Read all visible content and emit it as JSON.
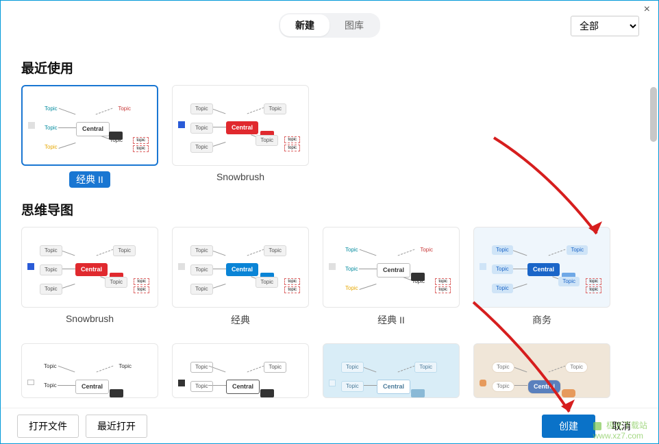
{
  "window": {
    "close": "×"
  },
  "header": {
    "tabs": [
      {
        "label": "新建",
        "active": true
      },
      {
        "label": "图库",
        "active": false
      }
    ],
    "filter_selected": "全部"
  },
  "sections": {
    "recent": {
      "title": "最近使用",
      "cards": [
        {
          "label": "经典 II",
          "selected": true,
          "theme": "classic2"
        },
        {
          "label": "Snowbrush",
          "selected": false,
          "theme": "snowbrush"
        }
      ]
    },
    "mindmap": {
      "title": "思维导图",
      "cards": [
        {
          "label": "Snowbrush",
          "theme": "snowbrush"
        },
        {
          "label": "经典",
          "theme": "classic"
        },
        {
          "label": "经典 II",
          "theme": "classic2"
        },
        {
          "label": "商务",
          "theme": "business"
        }
      ],
      "cards_row2": [
        {
          "label": "",
          "theme": "plain"
        },
        {
          "label": "",
          "theme": "dark"
        },
        {
          "label": "",
          "theme": "sky"
        },
        {
          "label": "",
          "theme": "warm"
        }
      ]
    }
  },
  "thumb_text": {
    "central": "Central",
    "topic": "Topic",
    "sub": "topic"
  },
  "footer": {
    "open_file": "打开文件",
    "recent_open": "最近打开",
    "create": "创建",
    "cancel": "取消"
  },
  "watermark": {
    "site_name": "极光下载站",
    "url": "www.xz7.com"
  }
}
